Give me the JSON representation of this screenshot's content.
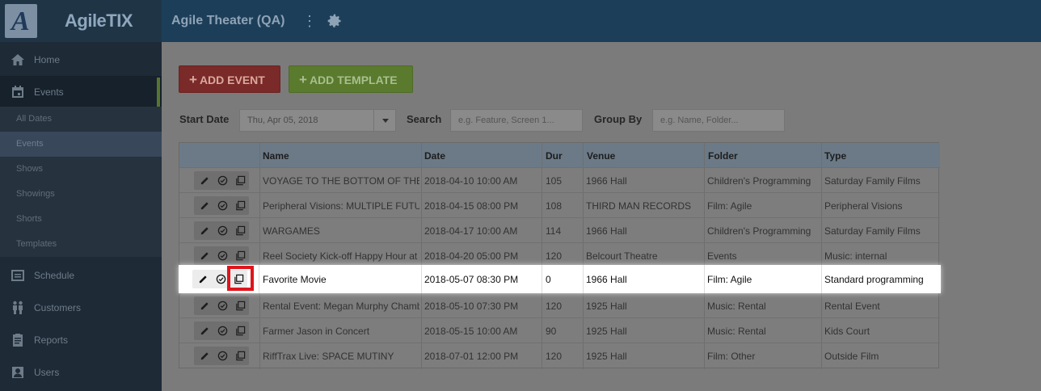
{
  "brand": {
    "logo_letter": "A",
    "name": "AgileTIX"
  },
  "header": {
    "org_name": "Agile Theater (QA)",
    "kebab_glyph": "⋮"
  },
  "sidebar": {
    "items": [
      {
        "label": "Home",
        "icon": "home-icon"
      },
      {
        "label": "Events",
        "icon": "calendar-icon",
        "active": true
      },
      {
        "label": "Schedule",
        "icon": "schedule-icon"
      },
      {
        "label": "Customers",
        "icon": "customers-icon"
      },
      {
        "label": "Reports",
        "icon": "clipboard-icon"
      },
      {
        "label": "Users",
        "icon": "user-icon"
      }
    ],
    "sub_items": [
      {
        "label": "All Dates"
      },
      {
        "label": "Events",
        "selected": true
      },
      {
        "label": "Shows"
      },
      {
        "label": "Showings"
      },
      {
        "label": "Shorts"
      },
      {
        "label": "Templates"
      }
    ]
  },
  "toolbar": {
    "plus_glyph": "+",
    "add_event_label": "ADD EVENT",
    "add_template_label": "ADD TEMPLATE"
  },
  "filters": {
    "start_date_label": "Start Date",
    "start_date_value": "Thu, Apr 05, 2018",
    "search_label": "Search",
    "search_placeholder": "e.g. Feature, Screen 1...",
    "group_by_label": "Group By",
    "group_by_placeholder": "e.g. Name, Folder..."
  },
  "table": {
    "columns": [
      "Name",
      "Date",
      "Dur",
      "Venue",
      "Folder",
      "Type"
    ],
    "rows": [
      [
        "VOYAGE TO THE BOTTOM OF THE SEA",
        "2018-04-10 10:00 AM",
        "105",
        "1966 Hall",
        "Children's Programming",
        "Saturday Family Films"
      ],
      [
        "Peripheral Visions: MULTIPLE FUTURES",
        "2018-04-15 08:00 PM",
        "108",
        "THIRD MAN RECORDS",
        "Film: Agile",
        "Peripheral Visions"
      ],
      [
        "WARGAMES",
        "2018-04-17 10:00 AM",
        "114",
        "1966 Hall",
        "Children's Programming",
        "Saturday Family Films"
      ],
      [
        "Reel Society Kick-off Happy Hour at",
        "2018-04-20 05:00 PM",
        "120",
        "Belcourt Theatre",
        "Events",
        "Music: internal"
      ],
      [
        "Favorite Movie",
        "2018-05-07 08:30 PM",
        "0",
        "1966 Hall",
        "Film: Agile",
        "Standard programming"
      ],
      [
        "Rental Event: Megan Murphy Chambers",
        "2018-05-10 07:30 PM",
        "120",
        "1925 Hall",
        "Music: Rental",
        "Rental Event"
      ],
      [
        "Farmer Jason in Concert",
        "2018-05-15 10:00 AM",
        "90",
        "1925 Hall",
        "Music: Rental",
        "Kids Court"
      ],
      [
        "RiffTrax Live: SPACE MUTINY",
        "2018-07-01 12:00 PM",
        "120",
        "1925 Hall",
        "Film: Other",
        "Outside Film"
      ]
    ],
    "highlighted_row": 4
  },
  "colors": {
    "accent_red": "#e0141c",
    "add_event": "#7a2a28",
    "add_template": "#5a7a2d"
  }
}
